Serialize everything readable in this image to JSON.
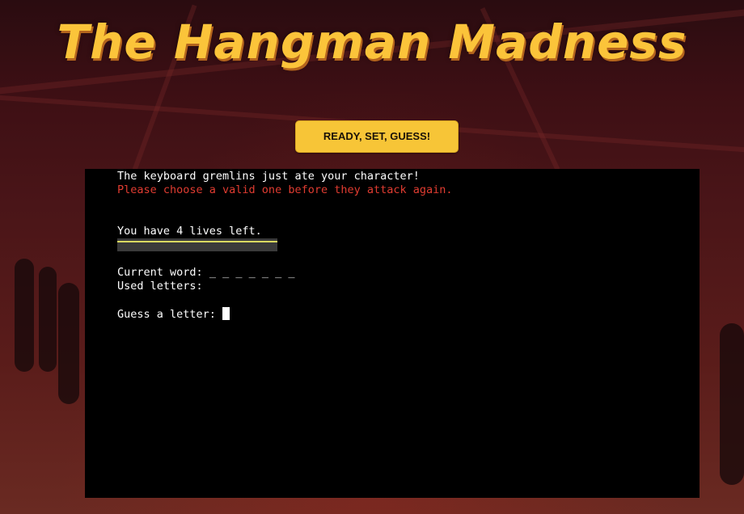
{
  "header": {
    "title": "The Hangman Madness"
  },
  "controls": {
    "start_button_label": "READY, SET, GUESS!"
  },
  "terminal": {
    "error_line_1": "The keyboard gremlins just ate your character!",
    "error_line_2": "Please choose a valid one before they attack again.",
    "lives_text": "You have 4 lives left.",
    "lives_remaining": 4,
    "current_word_label": "Current word:",
    "current_word_value": "_ _ _ _ _ _ _",
    "used_letters_label": "Used letters:",
    "used_letters_value": "",
    "prompt_label": "Guess a letter:"
  },
  "colors": {
    "title": "#fbc43a",
    "button_bg": "#f7c537",
    "terminal_bg": "#000000",
    "terminal_text": "#ffffff",
    "error_text": "#e03c31"
  }
}
